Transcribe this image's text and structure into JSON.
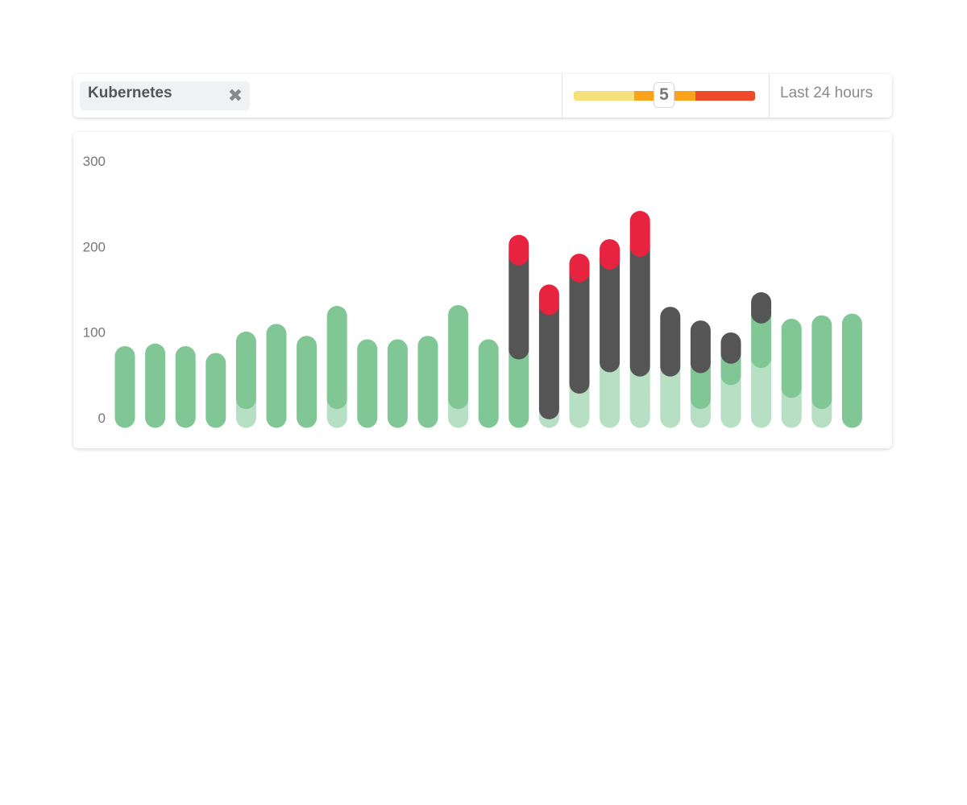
{
  "filters": {
    "chip_label": "Kubernetes",
    "chip_close_icon": "close-x-icon"
  },
  "severity": {
    "value": "5",
    "segments": [
      {
        "color": "#f6e07a",
        "share": 0.335
      },
      {
        "color": "#f9a21b",
        "share": 0.335
      },
      {
        "color": "#ee4a2a",
        "share": 0.33
      }
    ]
  },
  "time_range": {
    "label": "Last 24 hours"
  },
  "chart_data": {
    "type": "bar",
    "stacked": true,
    "ylim": [
      0,
      300
    ],
    "yticks": [
      "0",
      "100",
      "200",
      "300"
    ],
    "grid": false,
    "legend": false,
    "colors": {
      "light_green": "#b6dfc3",
      "green": "#81c796",
      "dark": "#555555",
      "red": "#e8233f"
    },
    "series": [
      {
        "color_key": "light_green",
        "values": [
          0,
          0,
          0,
          0,
          22,
          0,
          0,
          22,
          0,
          0,
          0,
          22,
          0,
          0,
          10,
          40,
          65,
          60,
          60,
          22,
          50,
          70,
          35,
          22,
          0
        ]
      },
      {
        "color_key": "green",
        "values": [
          72,
          75,
          72,
          64,
          67,
          98,
          84,
          97,
          80,
          80,
          84,
          98,
          80,
          80,
          0,
          0,
          0,
          0,
          0,
          42,
          25,
          52,
          69,
          86,
          110
        ]
      },
      {
        "color_key": "dark",
        "values": [
          0,
          0,
          0,
          0,
          0,
          0,
          0,
          0,
          0,
          0,
          0,
          0,
          0,
          110,
          122,
          130,
          120,
          140,
          58,
          38,
          13,
          13,
          0,
          0,
          0
        ]
      },
      {
        "color_key": "red",
        "values": [
          0,
          0,
          0,
          0,
          0,
          0,
          0,
          0,
          0,
          0,
          0,
          0,
          0,
          12,
          12,
          10,
          12,
          30,
          0,
          0,
          0,
          0,
          0,
          0,
          0
        ]
      }
    ]
  }
}
